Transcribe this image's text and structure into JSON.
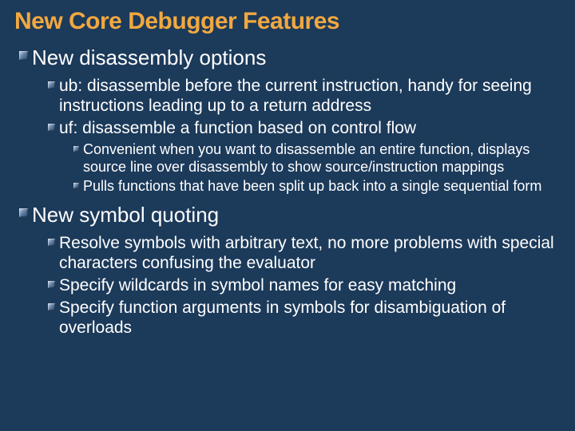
{
  "title": "New Core Debugger Features",
  "topics": [
    {
      "heading": "New disassembly options",
      "items": [
        {
          "text": "ub: disassemble before the current instruction, handy for seeing instructions leading up to a return address",
          "sub": []
        },
        {
          "text": "uf: disassemble a function based on control flow",
          "sub": [
            "Convenient when you want to disassemble an entire function, displays source line over disassembly to show source/instruction mappings",
            "Pulls functions that have been split up back into a single sequential form"
          ]
        }
      ]
    },
    {
      "heading": "New symbol quoting",
      "items": [
        {
          "text": "Resolve symbols with arbitrary text, no more problems with special characters confusing the evaluator",
          "sub": []
        },
        {
          "text": "Specify wildcards in symbol names for easy matching",
          "sub": []
        },
        {
          "text": "Specify function arguments in symbols for disambiguation of overloads",
          "sub": []
        }
      ]
    }
  ]
}
